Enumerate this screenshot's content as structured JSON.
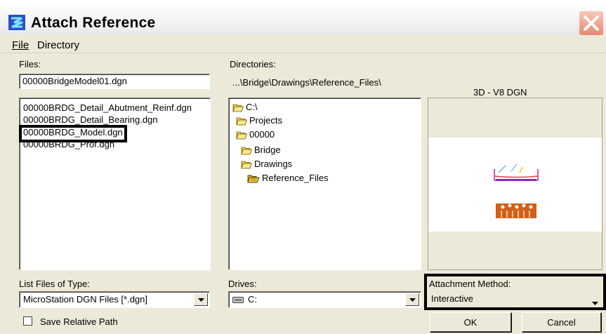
{
  "window": {
    "title": "Attach Reference",
    "app_icon": "microstation-icon",
    "close_icon": "close-icon"
  },
  "menu": {
    "items": [
      {
        "label": "File"
      },
      {
        "label": "Directory"
      }
    ]
  },
  "files": {
    "label": "Files:",
    "filename_value": "00000BridgeModel01.dgn",
    "items": [
      "00000BRDG_Detail_Abutment_Reinf.dgn",
      "00000BRDG_Detail_Bearing.dgn",
      "00000BRDG_Model.dgn",
      "00000BRDG_Prof.dgn"
    ],
    "selected_index": 2
  },
  "directories": {
    "label": "Directories:",
    "current_path": "...\\Bridge\\Drawings\\Reference_Files\\",
    "tree": [
      {
        "label": "C:\\",
        "icon": "folder-open-icon",
        "depth": 0
      },
      {
        "label": "Projects",
        "icon": "folder-open-icon",
        "depth": 1
      },
      {
        "label": "00000",
        "icon": "folder-open-icon",
        "depth": 1
      },
      {
        "label": "Bridge",
        "icon": "folder-open-icon",
        "depth": 2
      },
      {
        "label": "Drawings",
        "icon": "folder-open-icon",
        "depth": 2
      },
      {
        "label": "Reference_Files",
        "icon": "folder-open-selected-icon",
        "depth": 3
      }
    ]
  },
  "preview": {
    "format_label": "3D - V8 DGN"
  },
  "file_type": {
    "label": "List Files of Type:",
    "value": "MicroStation DGN Files [*.dgn]"
  },
  "drives": {
    "label": "Drives:",
    "value": "C:",
    "icon": "drive-icon"
  },
  "attachment_method": {
    "label": "Attachment Method:",
    "value": "Interactive"
  },
  "save_relative_path": {
    "label": "Save Relative Path",
    "checked": false
  },
  "buttons": {
    "ok": "OK",
    "cancel": "Cancel"
  }
}
